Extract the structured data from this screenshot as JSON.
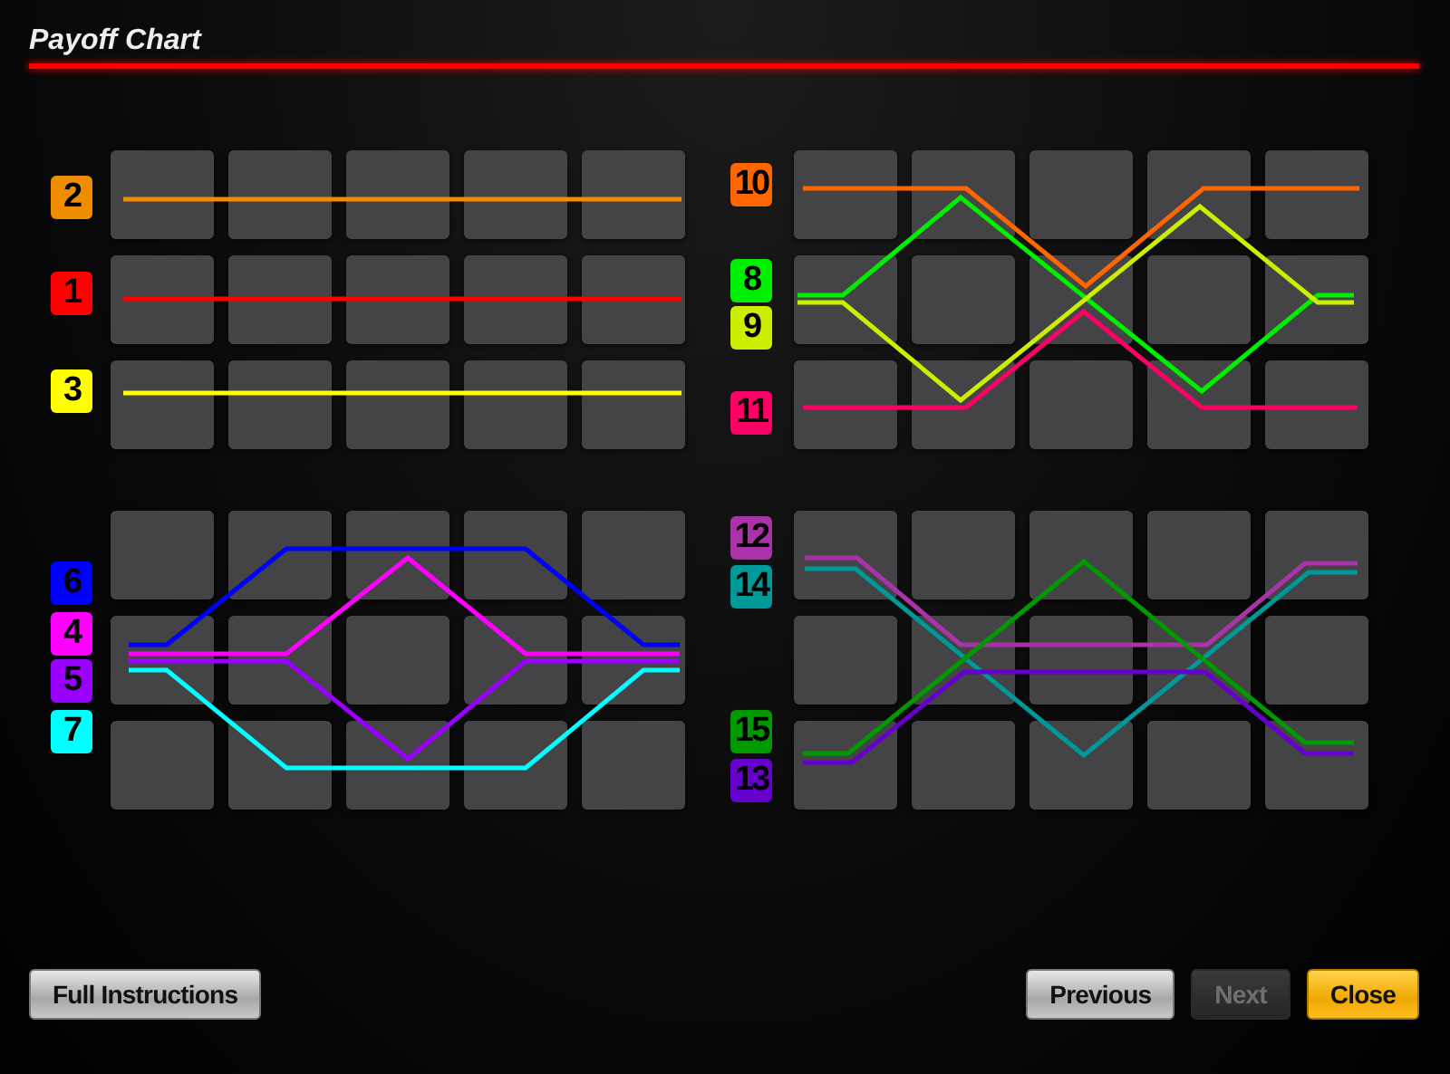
{
  "title": "Payoff Chart",
  "panel_rows": [
    {
      "panels": [
        {
          "lines": [
            {
              "label": "2",
              "color": "#f08c00"
            },
            {
              "label": "1",
              "color": "#ff0000"
            },
            {
              "label": "3",
              "color": "#ffff00"
            }
          ]
        },
        {
          "lines": [
            {
              "label": "10",
              "color": "#ff6600"
            },
            {
              "label": "8",
              "color": "#00ee00"
            },
            {
              "label": "9",
              "color": "#ccee00"
            },
            {
              "label": "11",
              "color": "#ff0066"
            }
          ]
        }
      ]
    },
    {
      "panels": [
        {
          "lines": [
            {
              "label": "6",
              "color": "#0000ff"
            },
            {
              "label": "4",
              "color": "#ff00ff"
            },
            {
              "label": "5",
              "color": "#9900ff"
            },
            {
              "label": "7",
              "color": "#00ffff"
            }
          ]
        },
        {
          "lines": [
            {
              "label": "12",
              "color": "#aa33aa"
            },
            {
              "label": "14",
              "color": "#009999"
            },
            {
              "label": "15",
              "color": "#009900"
            },
            {
              "label": "13",
              "color": "#6600cc"
            }
          ]
        }
      ]
    }
  ],
  "buttons": [
    {
      "label": "Full Instructions",
      "kind": "default",
      "disabled": false
    },
    {
      "label": "Previous",
      "kind": "default",
      "disabled": false
    },
    {
      "label": "Next",
      "kind": "default",
      "disabled": true
    },
    {
      "label": "Close",
      "kind": "primary",
      "disabled": false
    }
  ]
}
